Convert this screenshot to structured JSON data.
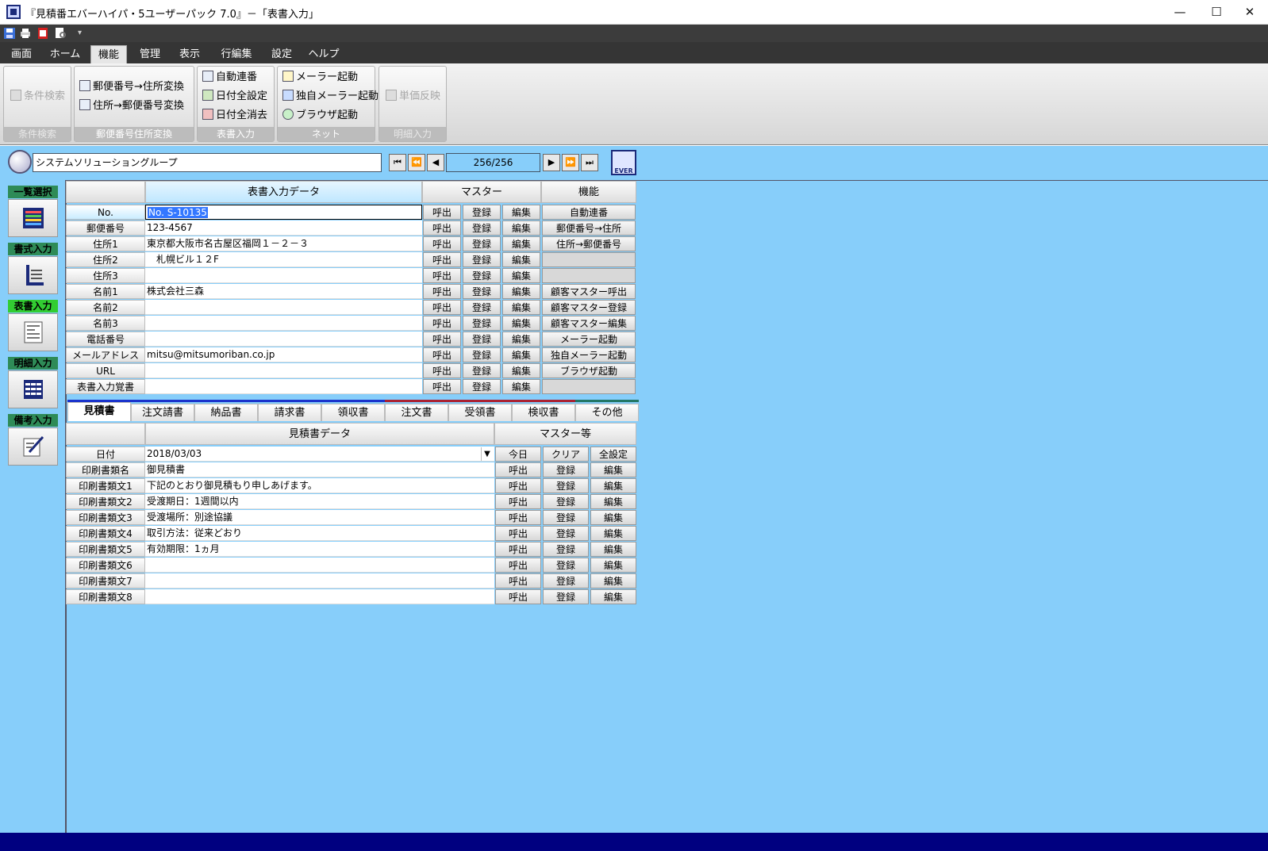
{
  "window": {
    "title": "『見積番エバーハイパ・5ユーザーパック 7.0』－「表書入力」",
    "minimize": "—",
    "maximize": "☐",
    "close": "✕"
  },
  "menu": {
    "tabs": [
      "画面",
      "ホーム",
      "機能",
      "管理",
      "表示",
      "行編集",
      "設定",
      "ヘルプ"
    ],
    "active": "機能"
  },
  "ribbon": {
    "groups": [
      {
        "title": "条件検索",
        "items": [
          "条件検索"
        ]
      },
      {
        "title": "郵便番号住所変換",
        "items": [
          "郵便番号→住所変換",
          "住所→郵便番号変換"
        ]
      },
      {
        "title": "表書入力",
        "items": [
          "自動連番",
          "日付全設定",
          "日付全消去"
        ]
      },
      {
        "title": "ネット",
        "items": [
          "メーラー起動",
          "独自メーラー起動",
          "ブラウザ起動"
        ]
      },
      {
        "title": "明細入力",
        "items": [
          "単価反映"
        ]
      }
    ]
  },
  "toolbar": {
    "company": "システムソリューショングループ",
    "record_counter": "256/256",
    "nav": [
      "⏮",
      "⏪",
      "◀",
      "▶",
      "⏩",
      "⏭"
    ],
    "ever_label": "EVER"
  },
  "sidebar": {
    "items": [
      {
        "label": "一覧選択",
        "icon": "list-grid-icon"
      },
      {
        "label": "書式入力",
        "icon": "format-ruler-icon"
      },
      {
        "label": "表書入力",
        "icon": "document-form-icon"
      },
      {
        "label": "明細入力",
        "icon": "detail-table-icon"
      },
      {
        "label": "備考入力",
        "icon": "pen-note-icon"
      }
    ]
  },
  "cover": {
    "header_data": "表書入力データ",
    "header_master": "マスター",
    "header_function": "機能",
    "master_buttons": [
      "呼出",
      "登録",
      "編集"
    ],
    "rows": [
      {
        "label": "No.",
        "value": "No. S-10135",
        "func": "自動連番"
      },
      {
        "label": "郵便番号",
        "value": "123-4567",
        "func": "郵便番号→住所"
      },
      {
        "label": "住所1",
        "value": "東京都大阪市名古屋区福岡１－２－３",
        "func": "住所→郵便番号"
      },
      {
        "label": "住所2",
        "value": "　札幌ビル１２F",
        "func": ""
      },
      {
        "label": "住所3",
        "value": "",
        "func": ""
      },
      {
        "label": "名前1",
        "value": "株式会社三森",
        "func": "顧客マスター呼出"
      },
      {
        "label": "名前2",
        "value": "",
        "func": "顧客マスター登録"
      },
      {
        "label": "名前3",
        "value": "",
        "func": "顧客マスター編集"
      },
      {
        "label": "電話番号",
        "value": "",
        "func": "メーラー起動"
      },
      {
        "label": "メールアドレス",
        "value": "mitsu@mitsumoriban.co.jp",
        "func": "独自メーラー起動"
      },
      {
        "label": "URL",
        "value": "",
        "func": "ブラウザ起動"
      },
      {
        "label": "表書入力覚書",
        "value": "",
        "func": ""
      }
    ]
  },
  "doc_tabs": {
    "items": [
      "見積書",
      "注文請書",
      "納品書",
      "請求書",
      "領収書",
      "注文書",
      "受領書",
      "検収書",
      "その他"
    ],
    "active": "見積書"
  },
  "estimate": {
    "header_data": "見積書データ",
    "header_master": "マスター等",
    "date_label": "日付",
    "date_value": "2018/03/03",
    "date_buttons": [
      "今日",
      "クリア",
      "全設定"
    ],
    "master_buttons": [
      "呼出",
      "登録",
      "編集"
    ],
    "rows": [
      {
        "label": "印刷書類名",
        "value": "御見積書"
      },
      {
        "label": "印刷書類文1",
        "value": "下記のとおり御見積もり申しあげます。"
      },
      {
        "label": "印刷書類文2",
        "value": "受渡期日：1週間以内"
      },
      {
        "label": "印刷書類文3",
        "value": "受渡場所：別途協議"
      },
      {
        "label": "印刷書類文4",
        "value": "取引方法：従来どおり"
      },
      {
        "label": "印刷書類文5",
        "value": "有効期限：1ヵ月"
      },
      {
        "label": "印刷書類文6",
        "value": ""
      },
      {
        "label": "印刷書類文7",
        "value": ""
      },
      {
        "label": "印刷書類文8",
        "value": ""
      }
    ]
  },
  "colors": {
    "workspace": "#87cefa",
    "statusbar": "#000080",
    "menubar": "#353535",
    "sidebar_label": "#2e8b57",
    "sidebar_label_active": "#32cd32"
  }
}
